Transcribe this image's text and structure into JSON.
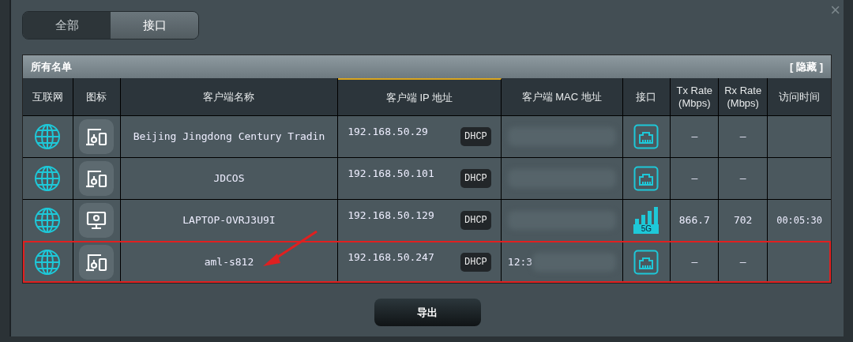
{
  "tabs": [
    {
      "label": "全部",
      "selected": false
    },
    {
      "label": "接口",
      "selected": true
    }
  ],
  "close": "×",
  "panel": {
    "title": "所有名单",
    "hide_link": "[ 隐藏 ]"
  },
  "table": {
    "columns": [
      {
        "label": "互联网",
        "sorted": false
      },
      {
        "label": "图标",
        "sorted": false
      },
      {
        "label": "客户端名称",
        "sorted": false
      },
      {
        "label": "客户端 IP 地址",
        "sorted": true
      },
      {
        "label": "客户端 MAC 地址",
        "sorted": false
      },
      {
        "label": "接口",
        "sorted": false
      },
      {
        "label": "Tx Rate (Mbps)",
        "sorted": false
      },
      {
        "label": "Rx Rate (Mbps)",
        "sorted": false
      },
      {
        "label": "访问时间",
        "sorted": false
      }
    ],
    "rows": [
      {
        "device": {
          "kind": "devices"
        },
        "name": "Beijing Jingdong Century Tradin",
        "ip": "192.168.50.29",
        "ip_type": "DHCP",
        "interface": {
          "kind": "wired"
        },
        "tx": "–",
        "rx": "–",
        "highlighted": false
      },
      {
        "device": {
          "kind": "devices"
        },
        "name": "JDCOS",
        "ip": "192.168.50.101",
        "ip_type": "DHCP",
        "interface": {
          "kind": "wired"
        },
        "tx": "–",
        "rx": "–",
        "highlighted": false
      },
      {
        "device": {
          "kind": "monitor"
        },
        "name": "LAPTOP-OVRJ3U9I",
        "ip": "192.168.50.129",
        "ip_type": "DHCP",
        "interface": {
          "kind": "wifi",
          "band": "5G"
        },
        "tx": "866.7",
        "rx": "702",
        "time": "00:05:30",
        "highlighted": false
      },
      {
        "device": {
          "kind": "devices"
        },
        "name": "aml-s812",
        "ip": "192.168.50.247",
        "ip_type": "DHCP",
        "mac": "12:3",
        "interface": {
          "kind": "wired"
        },
        "tx": "–",
        "rx": "–",
        "highlighted": true
      }
    ]
  },
  "export_button": "导出"
}
